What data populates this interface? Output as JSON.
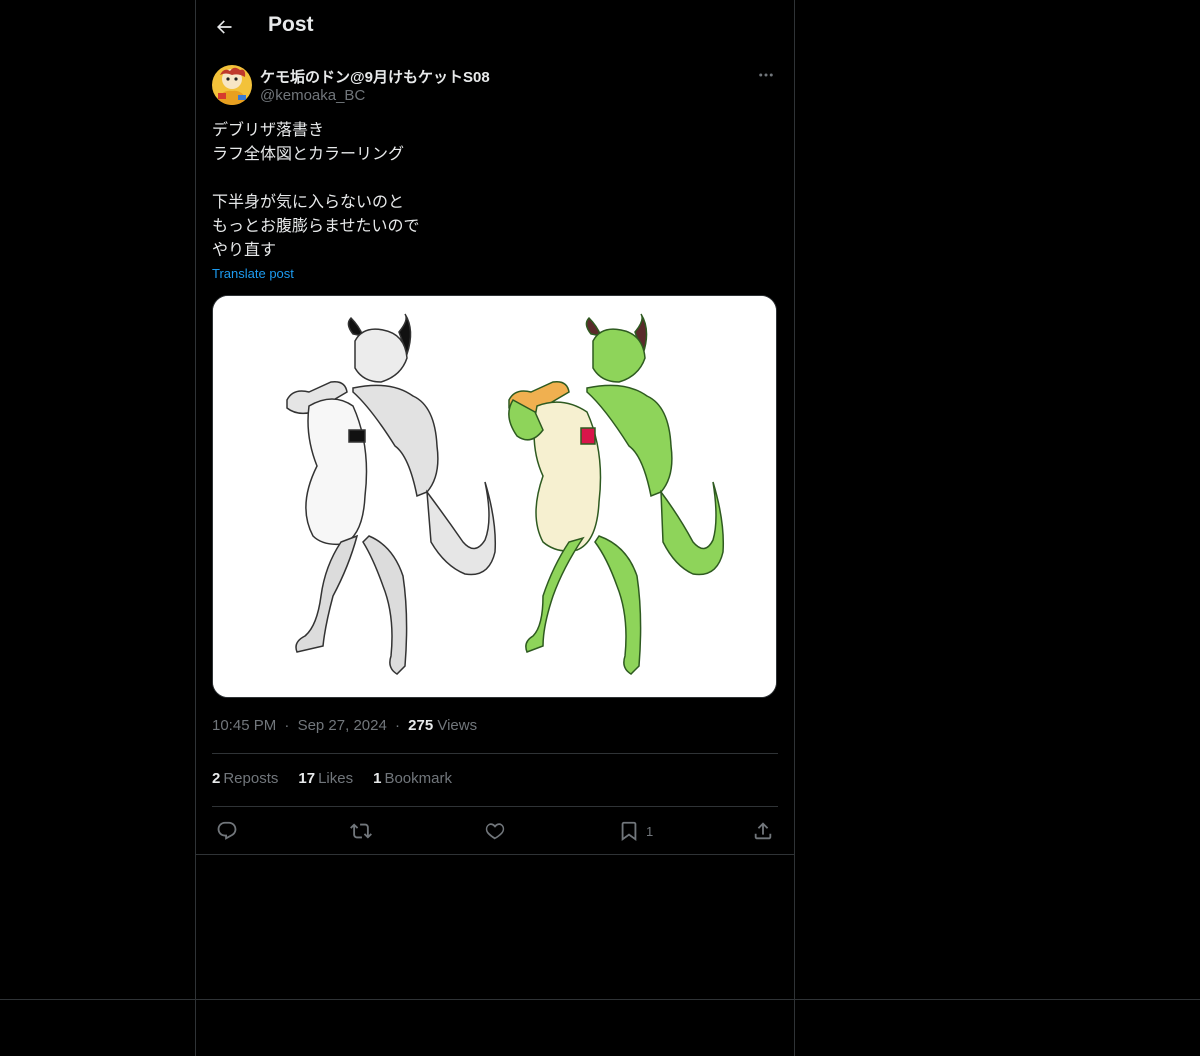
{
  "header": {
    "title": "Post",
    "back_icon": "arrow-left-icon"
  },
  "author": {
    "display_name": "ケモ垢のドン@9月けもケットS08",
    "handle": "@kemoaka_BC"
  },
  "post": {
    "lines": [
      "デブリザ落書き",
      "ラフ全体図とカラーリング",
      "",
      "下半身が気に入らないのと",
      "もっとお腹膨らませたいので",
      "やり直す"
    ],
    "translate_label": "Translate post"
  },
  "meta": {
    "time": "10:45 PM",
    "dot1": "·",
    "date": "Sep 27, 2024",
    "dot2": "·",
    "views_count": "275",
    "views_label": "Views"
  },
  "stats": {
    "reposts_count": "2",
    "reposts_label": "Reposts",
    "likes_count": "17",
    "likes_label": "Likes",
    "bookmarks_count": "1",
    "bookmarks_label": "Bookmark"
  },
  "actions": {
    "reply_icon": "reply-icon",
    "repost_icon": "repost-icon",
    "like_icon": "heart-icon",
    "bookmark_icon": "bookmark-icon",
    "bookmark_count": "1",
    "share_icon": "share-icon"
  },
  "colors": {
    "background": "#000000",
    "text_primary": "#e7e9ea",
    "text_secondary": "#71767b",
    "link": "#1d9bf0",
    "border": "#2f3336",
    "dragon_green": "#8ed45a"
  }
}
